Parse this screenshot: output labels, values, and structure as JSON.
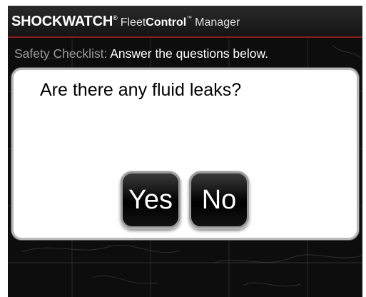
{
  "header": {
    "brand_shock": "SHOCKWATCH",
    "brand_reg": "®",
    "brand_fleet": "Fleet",
    "brand_control": "Control",
    "brand_tm": "™",
    "brand_manager": "Manager"
  },
  "subtitle": {
    "label": "Safety Checklist:",
    "text": "Answer the questions below."
  },
  "dialog": {
    "question": "Are there any fluid leaks?",
    "yes_label": "Yes",
    "no_label": "No"
  },
  "colors": {
    "header_rule": "#8a1c1c",
    "background": "#0d0d0d",
    "dialog": "#ffffff"
  }
}
